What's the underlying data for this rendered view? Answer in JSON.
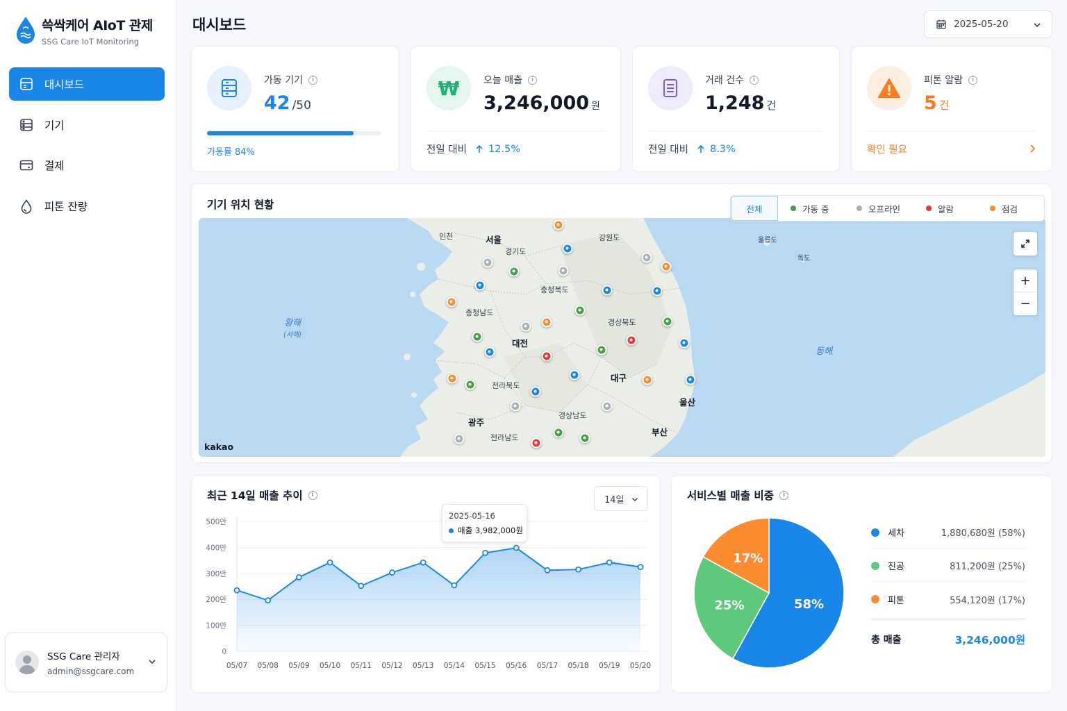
{
  "brand": {
    "title": "쓱싹케어 AIoT 관제",
    "subtitle": "SSG Care IoT Monitoring"
  },
  "nav": [
    {
      "label": "대시보드",
      "icon": "dashboard-icon",
      "active": true
    },
    {
      "label": "기기",
      "icon": "device-icon",
      "active": false
    },
    {
      "label": "결제",
      "icon": "card-icon",
      "active": false
    },
    {
      "label": "피톤 잔량",
      "icon": "drop-icon",
      "active": false
    }
  ],
  "user": {
    "name": "SSG Care 관리자",
    "email": "admin@ssgcare.com"
  },
  "header": {
    "title": "대시보드",
    "date": "2025-05-20"
  },
  "kpis": {
    "devices": {
      "label": "가동 기기",
      "value": "42",
      "unit": "/50",
      "rate_label": "가동률 84%",
      "rate": 0.84
    },
    "sales": {
      "label": "오늘 매출",
      "value": "3,246,000",
      "unit": "원",
      "compare_label": "전일 대비",
      "change": "12.5%"
    },
    "transactions": {
      "label": "거래 건수",
      "value": "1,248",
      "unit": "건",
      "compare_label": "전일 대비",
      "change": "8.3%"
    },
    "alarms": {
      "label": "피톤 알람",
      "value": "5",
      "unit": "건",
      "action": "확인 필요"
    }
  },
  "map": {
    "title": "기기 위치 현황",
    "filter_all": "전체",
    "legend": [
      {
        "label": "가동 중",
        "color": "#43a047"
      },
      {
        "label": "오프라인",
        "color": "#a9b0ba"
      },
      {
        "label": "알람",
        "color": "#e53935"
      },
      {
        "label": "점검",
        "color": "#fb8c2f"
      }
    ],
    "attribution": "kakao",
    "labels": {
      "incheon": "인천",
      "seoul": "서울",
      "gyeonggi": "경기도",
      "gangwon": "강원도",
      "chungbuk": "충청북도",
      "chungnam": "충청남도",
      "daejeon": "대전",
      "gyeongbuk": "경상북도",
      "jeonbuk": "전라북도",
      "daegu": "대구",
      "ulsan": "울산",
      "gwangju": "광주",
      "gyeongnam": "경상남도",
      "jeonnam": "전라남도",
      "busan": "부산",
      "ulleung": "울릉도",
      "dokdo": "독도",
      "yellow_sea": "황해",
      "yellow_sea_sub": "(서해)",
      "east_sea": "동해"
    }
  },
  "line_chart": {
    "title": "최근 14일 매출 추이",
    "range": "14일",
    "tooltip": {
      "date": "2025-05-16",
      "label": "매출 3,982,000원"
    }
  },
  "chart_data": {
    "type": "area",
    "x": [
      "05/07",
      "05/08",
      "05/09",
      "05/10",
      "05/11",
      "05/12",
      "05/13",
      "05/14",
      "05/15",
      "05/16",
      "05/17",
      "05/18",
      "05/19",
      "05/20"
    ],
    "y": [
      2350000,
      1960000,
      2850000,
      3420000,
      2520000,
      3030000,
      3420000,
      2540000,
      3790000,
      3982000,
      3120000,
      3150000,
      3420000,
      3246000
    ],
    "y_ticks": [
      "0",
      "100만",
      "200만",
      "300만",
      "400만",
      "500만"
    ],
    "ylim": [
      0,
      5000000
    ],
    "color": "#1a86e8",
    "grid": true
  },
  "pie": {
    "title": "서비스별 매출 비중",
    "slices": [
      {
        "name": "세차",
        "value": "1,880,680원 (58%)",
        "pct": 58,
        "label": "58%",
        "color": "#1a86e8"
      },
      {
        "name": "진공",
        "value": "811,200원 (25%)",
        "pct": 25,
        "label": "25%",
        "color": "#5ec97b"
      },
      {
        "name": "피톤",
        "value": "554,120원 (17%)",
        "pct": 17,
        "label": "17%",
        "color": "#fb8c2f"
      }
    ],
    "total_label": "총 매출",
    "total_value": "3,246,000원"
  }
}
